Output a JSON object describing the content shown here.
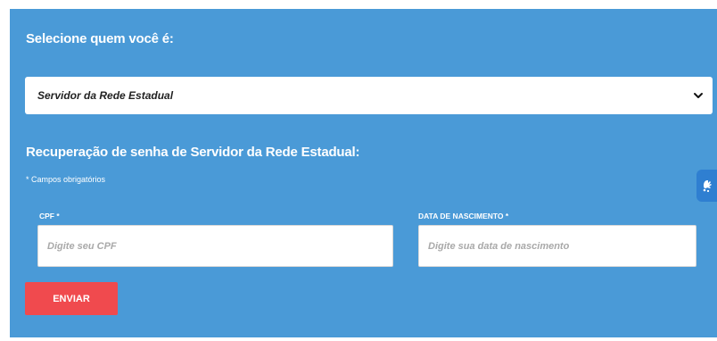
{
  "selection": {
    "heading": "Selecione quem você é:",
    "selected_value": "Servidor da Rede Estadual"
  },
  "form": {
    "heading": "Recuperação de senha de Servidor da Rede Estadual:",
    "required_note": "* Campos obrigatórios",
    "cpf": {
      "label": "CPF *",
      "placeholder": "Digite seu CPF"
    },
    "birth_date": {
      "label": "DATA DE NASCIMENTO *",
      "placeholder": "Digite sua data de nascimento"
    },
    "submit_label": "ENVIAR"
  },
  "icons": {
    "select_chevron": "chevron-down-icon",
    "accessibility": "sign-language-icon"
  },
  "colors": {
    "panel_background": "#4a9ad7",
    "submit_button": "#f04a4e",
    "accessibility_button": "#2f7fd1"
  }
}
